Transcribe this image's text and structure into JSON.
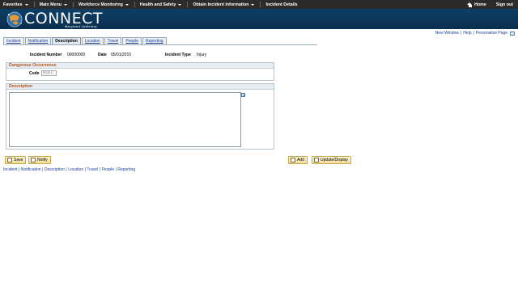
{
  "topnav": {
    "menu": [
      {
        "label": "Favorites",
        "has_caret": true
      },
      {
        "label": "Main Menu",
        "has_caret": true
      },
      {
        "label": "Workforce Monitoring",
        "has_caret": true
      },
      {
        "label": "Health and Safety",
        "has_caret": true
      },
      {
        "label": "Obtain Incident Information",
        "has_caret": true
      },
      {
        "label": "Incident Details",
        "has_caret": false
      }
    ],
    "home_label": "Home",
    "signout_label": "Sign out"
  },
  "banner": {
    "brand": "CONNECT",
    "subtitle": "Maryland Judiciary"
  },
  "utility_links": [
    "New Window",
    "Help",
    "Personalize Page"
  ],
  "tabs": [
    {
      "label": "Incident",
      "active": false
    },
    {
      "label": "Notification",
      "active": false
    },
    {
      "label": "Description",
      "active": true
    },
    {
      "label": "Location",
      "active": false
    },
    {
      "label": "Travel",
      "active": false
    },
    {
      "label": "People",
      "active": false
    },
    {
      "label": "Reporting",
      "active": false
    }
  ],
  "header": {
    "incident_number_label": "Incident Number",
    "incident_number_value": "00000000",
    "date_label": "Date",
    "date_value": "05/01/2015",
    "incident_type_label": "Incident Type",
    "incident_type_value": "Injury"
  },
  "dangerous_occurrence": {
    "title": "Dangerous Occurrence",
    "code_label": "Code",
    "code_value": "NULL"
  },
  "description": {
    "title": "Description",
    "value": ""
  },
  "buttons": {
    "save": "Save",
    "notify": "Notify",
    "add": "Add",
    "update_display": "Update/Display"
  },
  "bottom_links": [
    "Incident",
    "Notification",
    "Description",
    "Location",
    "Travel",
    "People",
    "Reporting"
  ],
  "colors": {
    "topbar": "#2b2b2b",
    "banner": "#0e3f66",
    "link": "#1a3d8f",
    "group_title": "#b85419",
    "button": "#f2dc98"
  }
}
